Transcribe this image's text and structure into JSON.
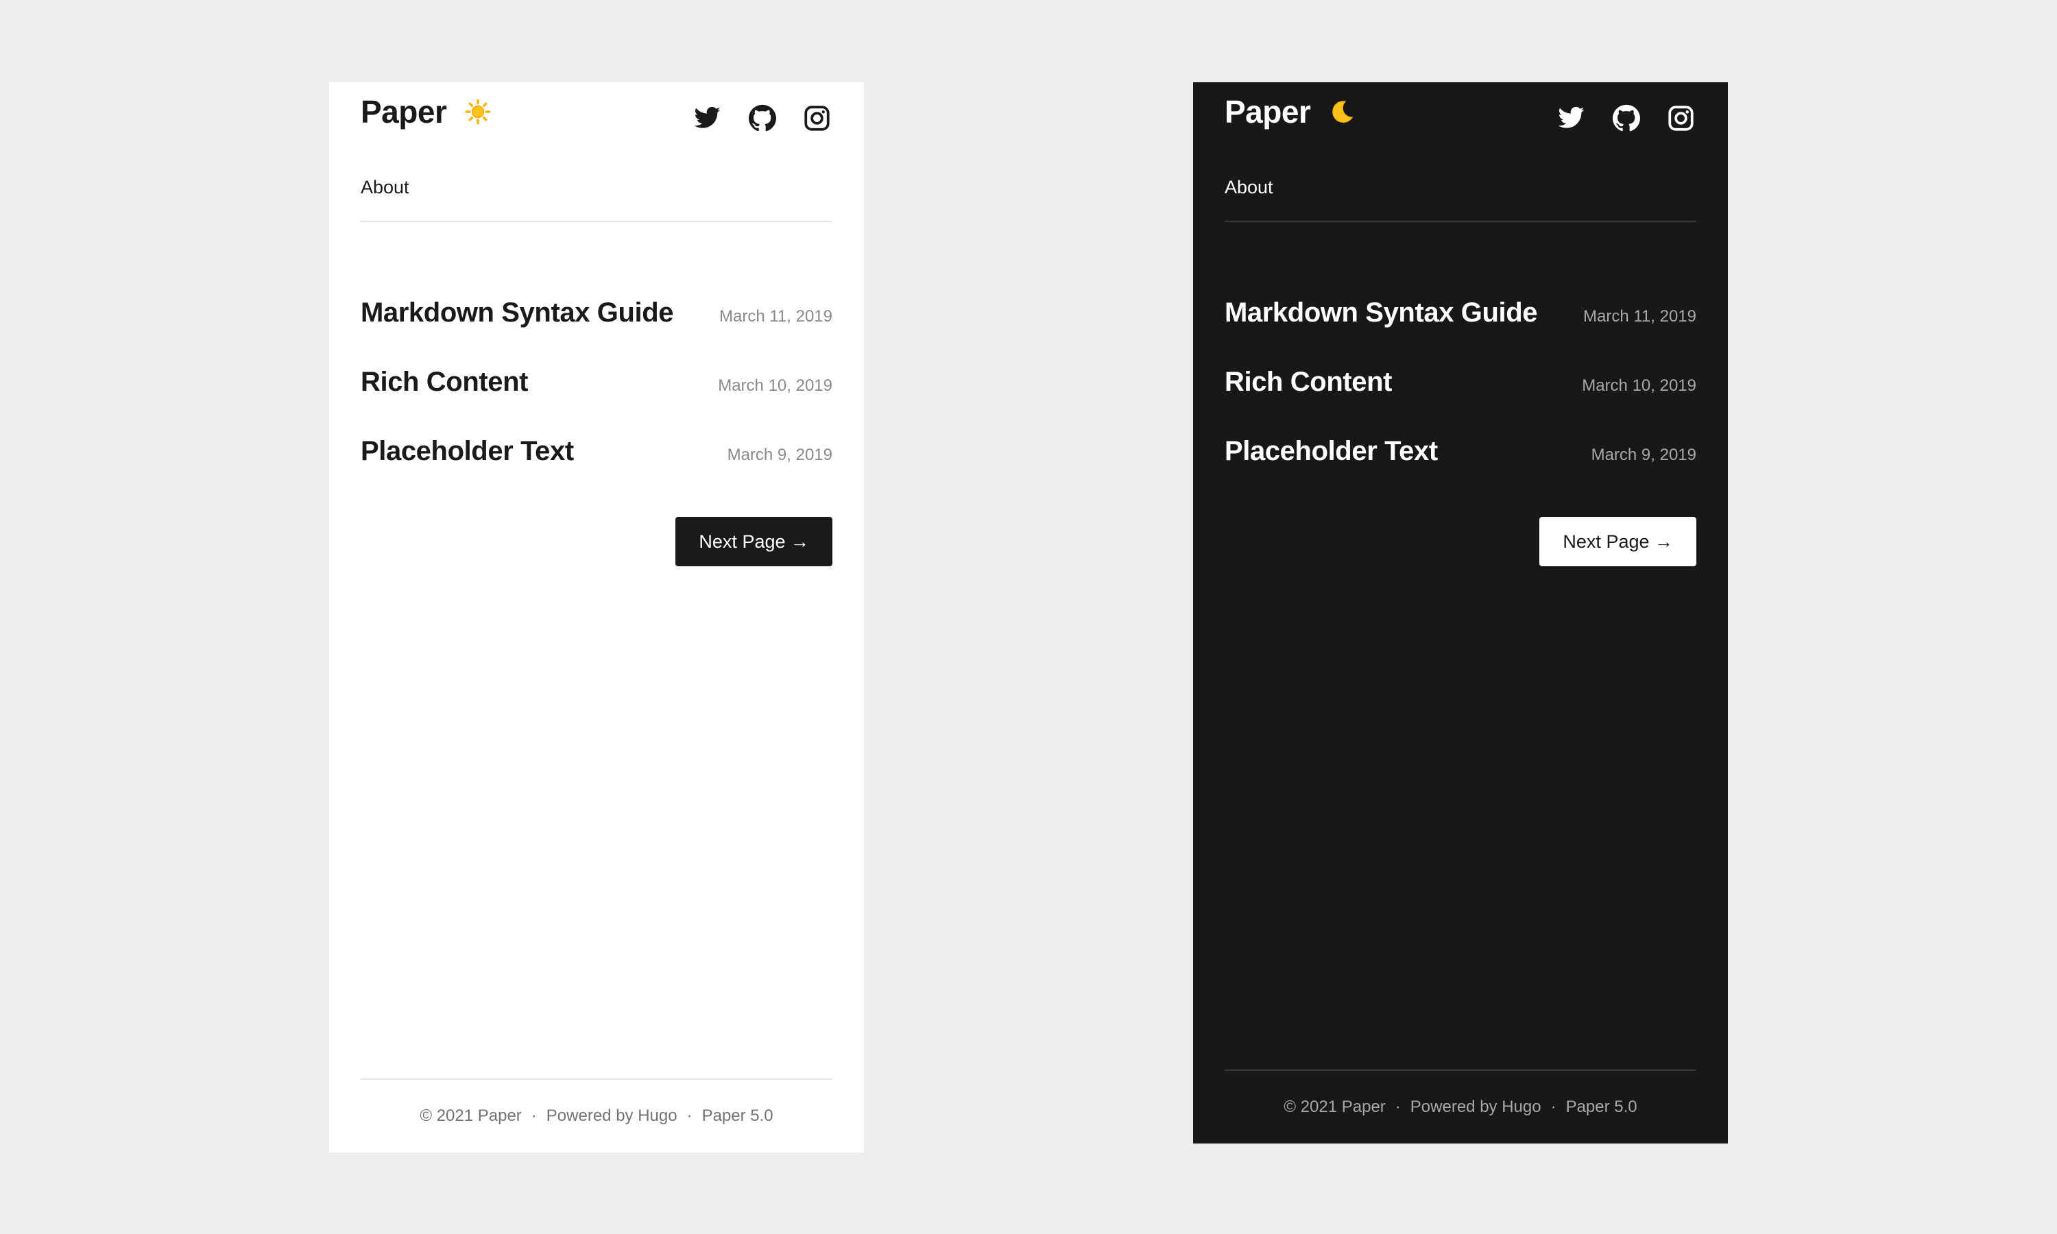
{
  "site": {
    "logo": "Paper",
    "nav": [
      {
        "label": "About"
      }
    ],
    "socials": [
      {
        "name": "twitter-icon"
      },
      {
        "name": "github-icon"
      },
      {
        "name": "instagram-icon"
      }
    ]
  },
  "light_theme": {
    "toggle_icon": "sun-icon",
    "background": "#ffffff",
    "text_color": "#1a1a1a"
  },
  "dark_theme": {
    "toggle_icon": "moon-icon",
    "background": "#181818",
    "text_color": "#ffffff"
  },
  "posts": [
    {
      "title": "Markdown Syntax Guide",
      "date": "March 11, 2019"
    },
    {
      "title": "Rich Content",
      "date": "March 10, 2019"
    },
    {
      "title": "Placeholder Text",
      "date": "March 9, 2019"
    }
  ],
  "pagination": {
    "next_label": "Next Page →"
  },
  "footer": {
    "copyright": "© 2021 Paper",
    "separator": "·",
    "powered": "Powered by Hugo",
    "version": "Paper 5.0"
  }
}
